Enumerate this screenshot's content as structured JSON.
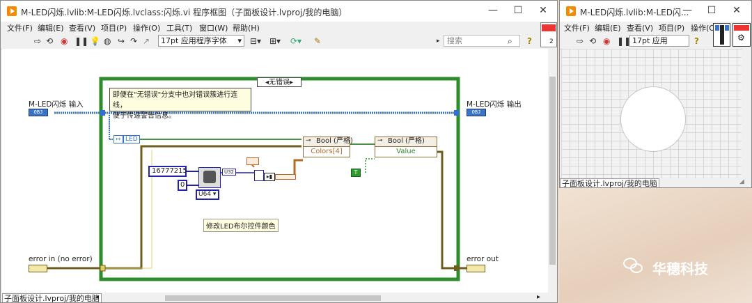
{
  "block_diagram": {
    "title": "M-LED闪烁.lvlib:M-LED闪烁.lvclass:闪烁.vi 程序框图（子面板设计.lvproj/我的电脑）",
    "window_controls": {
      "minimize": "—",
      "maximize": "☐",
      "close": "✕"
    },
    "menus": [
      "文件(F)",
      "编辑(E)",
      "查看(V)",
      "项目(P)",
      "操作(O)",
      "工具(T)",
      "窗口(W)",
      "帮助(H)"
    ],
    "font_selector": "17pt 应用程序字体",
    "search_placeholder": "搜索",
    "help_label": "?",
    "context_badge": "2",
    "case_selector": "无错误",
    "comment_text": "即便在\"无错误\"分支中也对错误簇进行连线，\n便于传递警告信息。",
    "class_in_label": "M-LED闪烁 输入",
    "class_out_label": "M-LED闪烁 输出",
    "error_in_label": "error in (no error)",
    "error_out_label": "error out",
    "obj_tag": "OBJ",
    "unbundle_item": "LED",
    "const_color": "16777215",
    "const_zero": "0",
    "type_u64": "U64 ▾",
    "type_u32": "U32",
    "prop_node1_head": "Bool (严格)",
    "prop_node1_item": "Colors[4]",
    "prop_node2_head": "Bool (严格)",
    "prop_node2_item": "Value",
    "bool_const": "T",
    "label_text": "修改LED布尔控件颜色",
    "project_path": "子面板设计.lvproj/我的电脑"
  },
  "front_panel": {
    "title": "M-LED闪烁.lvlib:M-LED闪...",
    "window_controls": {
      "minimize": "—",
      "maximize": "☐",
      "close": "✕"
    },
    "menus": [
      "文件(F)",
      "编辑(E)",
      "查看(V)",
      "项目(P)",
      "操作(O)"
    ],
    "font_selector": "17pt 应用",
    "help_label": "?",
    "project_path": "子面板设计.lvproj/我的电脑"
  },
  "watermark": "华穗科技"
}
